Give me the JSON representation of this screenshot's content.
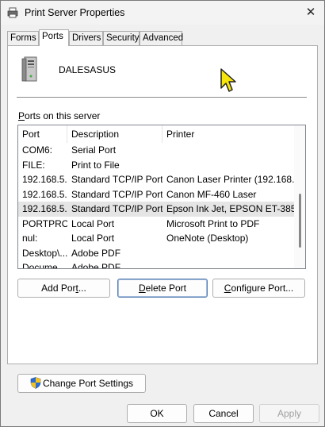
{
  "window": {
    "title": "Print Server Properties",
    "close_glyph": "✕"
  },
  "tabs": [
    {
      "label": "Forms"
    },
    {
      "label": "Ports",
      "active": true
    },
    {
      "label": "Drivers"
    },
    {
      "label": "Security"
    },
    {
      "label": "Advanced"
    }
  ],
  "server": {
    "name": "DALESASUS",
    "icon": "server-tower-icon"
  },
  "ports_section": {
    "label_prefix": "P",
    "label_rest": "orts on this server"
  },
  "listview": {
    "columns": [
      "Port",
      "Description",
      "Printer"
    ],
    "rows": [
      {
        "port": "COM6:",
        "description": "Serial Port",
        "printer": ""
      },
      {
        "port": "FILE:",
        "description": "Print to File",
        "printer": ""
      },
      {
        "port": "192.168.5...",
        "description": "Standard TCP/IP Port",
        "printer": "Canon Laser Printer (192.168..."
      },
      {
        "port": "192.168.5...",
        "description": "Standard TCP/IP Port",
        "printer": "Canon MF-460 Laser"
      },
      {
        "port": "192.168.5...",
        "description": "Standard TCP/IP Port",
        "printer": "Epson Ink Jet, EPSON ET-385...",
        "selected": true
      },
      {
        "port": "PORTPRO...",
        "description": "Local Port",
        "printer": "Microsoft Print to PDF"
      },
      {
        "port": "nul:",
        "description": "Local Port",
        "printer": "OneNote (Desktop)"
      },
      {
        "port": "Desktop\\...",
        "description": "Adobe PDF",
        "printer": ""
      },
      {
        "port": "Docume...",
        "description": "Adobe PDF",
        "printer": ""
      }
    ]
  },
  "buttons": {
    "add_port": {
      "label_pre": "Add Por",
      "label_ul": "t",
      "label_post": "..."
    },
    "delete_port": {
      "label_ul": "D",
      "label_post": "elete Port"
    },
    "configure_port": {
      "label_ul": "C",
      "label_post": "onfigure Port..."
    },
    "change_port_settings": {
      "label_pre": "Chan",
      "label_ul": "g",
      "label_post": "e Port Settings"
    },
    "ok": "OK",
    "cancel": "Cancel",
    "apply": "Apply"
  },
  "colors": {
    "accent": "#5a7fb0",
    "selected_row": "#e5e5e5",
    "cursor": "#f5e50b"
  }
}
